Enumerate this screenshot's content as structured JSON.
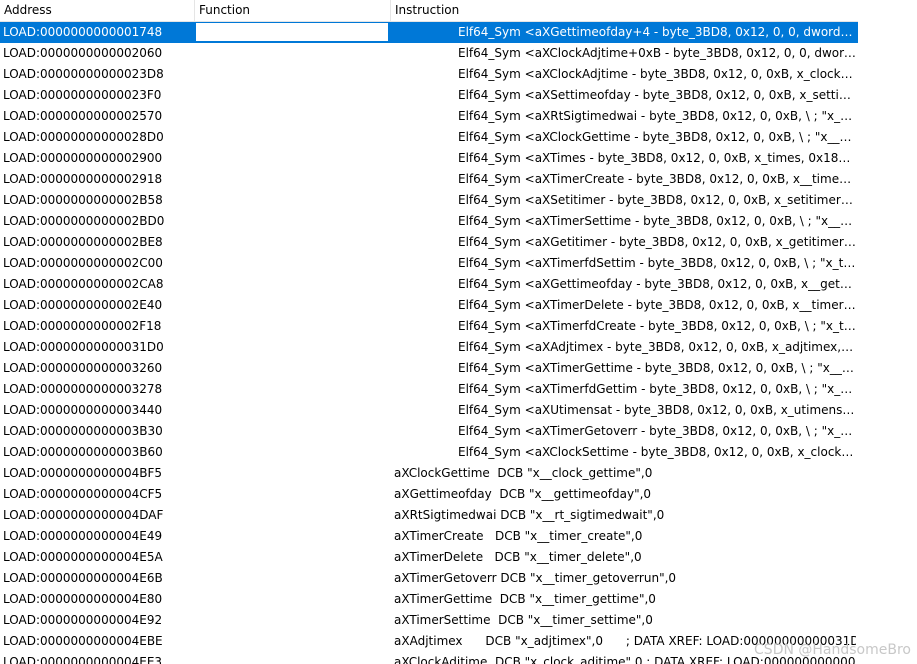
{
  "columns": {
    "address": "Address",
    "function": "Function",
    "instruction": "Instruction"
  },
  "rows": [
    {
      "address": "LOAD:0000000000001748",
      "instruction": "Elf64_Sym <aXGettimeofday+4 - byte_3BD8, 0x12, 0, 0, dword_0, 0..."
    },
    {
      "address": "LOAD:0000000000002060",
      "instruction": "Elf64_Sym <aXClockAdjtime+0xB - byte_3BD8, 0x12, 0, 0, dword_0,..."
    },
    {
      "address": "LOAD:00000000000023D8",
      "instruction": "Elf64_Sym <aXClockAdjtime - byte_3BD8, 0x12, 0, 0xB, x_clock_adjt..."
    },
    {
      "address": "LOAD:00000000000023F0",
      "instruction": "Elf64_Sym <aXSettimeofday - byte_3BD8, 0x12, 0, 0xB, x_settimeof..."
    },
    {
      "address": "LOAD:0000000000002570",
      "instruction": "Elf64_Sym <aXRtSigtimedwai - byte_3BD8, 0x12, 0, 0xB, \\ ; \"x__rt_s..."
    },
    {
      "address": "LOAD:00000000000028D0",
      "instruction": "Elf64_Sym <aXClockGettime - byte_3BD8, 0x12, 0, 0xB, \\ ; \"x__cloc..."
    },
    {
      "address": "LOAD:0000000000002900",
      "instruction": "Elf64_Sym <aXTimes - byte_3BD8, 0x12, 0, 0xB, x_times, 0x18> ; \"x..."
    },
    {
      "address": "LOAD:0000000000002918",
      "instruction": "Elf64_Sym <aXTimerCreate - byte_3BD8, 0x12, 0, 0xB, x__timer_cre..."
    },
    {
      "address": "LOAD:0000000000002B58",
      "instruction": "Elf64_Sym <aXSetitimer - byte_3BD8, 0x12, 0, 0xB, x_setitimer, 0x1..."
    },
    {
      "address": "LOAD:0000000000002BD0",
      "instruction": "Elf64_Sym <aXTimerSettime - byte_3BD8, 0x12, 0, 0xB, \\ ; \"x__time..."
    },
    {
      "address": "LOAD:0000000000002BE8",
      "instruction": "Elf64_Sym <aXGetitimer - byte_3BD8, 0x12, 0, 0xB, x_getitimer, 0x1..."
    },
    {
      "address": "LOAD:0000000000002C00",
      "instruction": "Elf64_Sym <aXTimerfdSettim - byte_3BD8, 0x12, 0, 0xB, \\ ; \"x_timer..."
    },
    {
      "address": "LOAD:0000000000002CA8",
      "instruction": "Elf64_Sym <aXGettimeofday - byte_3BD8, 0x12, 0, 0xB, x__gettime..."
    },
    {
      "address": "LOAD:0000000000002E40",
      "instruction": "Elf64_Sym <aXTimerDelete - byte_3BD8, 0x12, 0, 0xB, x__timer_del..."
    },
    {
      "address": "LOAD:0000000000002F18",
      "instruction": "Elf64_Sym <aXTimerfdCreate - byte_3BD8, 0x12, 0, 0xB, \\ ; \"x_timer..."
    },
    {
      "address": "LOAD:00000000000031D0",
      "instruction": "Elf64_Sym <aXAdjtimex - byte_3BD8, 0x12, 0, 0xB, x_adjtimex, 0x18..."
    },
    {
      "address": "LOAD:0000000000003260",
      "instruction": "Elf64_Sym <aXTimerGettime - byte_3BD8, 0x12, 0, 0xB, \\ ; \"x__time..."
    },
    {
      "address": "LOAD:0000000000003278",
      "instruction": "Elf64_Sym <aXTimerfdGettim - byte_3BD8, 0x12, 0, 0xB, \\ ; \"x_timer..."
    },
    {
      "address": "LOAD:0000000000003440",
      "instruction": "Elf64_Sym <aXUtimensat - byte_3BD8, 0x12, 0, 0xB, x_utimensat, 0x..."
    },
    {
      "address": "LOAD:0000000000003B30",
      "instruction": "Elf64_Sym <aXTimerGetoverr - byte_3BD8, 0x12, 0, 0xB, \\ ; \"x__tim..."
    },
    {
      "address": "LOAD:0000000000003B60",
      "instruction": "Elf64_Sym <aXClockSettime - byte_3BD8, 0x12, 0, 0xB, x_clock_setti..."
    },
    {
      "address": "LOAD:0000000000004BF5",
      "instruction": "aXClockGettime  DCB \"x__clock_gettime\",0"
    },
    {
      "address": "LOAD:0000000000004CF5",
      "instruction": "aXGettimeofday  DCB \"x__gettimeofday\",0"
    },
    {
      "address": "LOAD:0000000000004DAF",
      "instruction": "aXRtSigtimedwai DCB \"x__rt_sigtimedwait\",0"
    },
    {
      "address": "LOAD:0000000000004E49",
      "instruction": "aXTimerCreate   DCB \"x__timer_create\",0"
    },
    {
      "address": "LOAD:0000000000004E5A",
      "instruction": "aXTimerDelete   DCB \"x__timer_delete\",0"
    },
    {
      "address": "LOAD:0000000000004E6B",
      "instruction": "aXTimerGetoverr DCB \"x__timer_getoverrun\",0"
    },
    {
      "address": "LOAD:0000000000004E80",
      "instruction": "aXTimerGettime  DCB \"x__timer_gettime\",0"
    },
    {
      "address": "LOAD:0000000000004E92",
      "instruction": "aXTimerSettime  DCB \"x__timer_settime\",0"
    },
    {
      "address": "LOAD:0000000000004EBE",
      "instruction": "aXAdjtimex      DCB \"x_adjtimex\",0      ; DATA XREF: LOAD:00000000000031D0..."
    },
    {
      "address": "LOAD:0000000000004EE3",
      "instruction": "aXClockAdjtime  DCB \"x_clock_adjtime\",0 ; DATA XREF: LOAD:0000000000000..."
    }
  ],
  "selected_row_index": 0,
  "data_row_start_index": 21,
  "watermark": "CSDN @HandsomeBro",
  "colors": {
    "selection": "#0078d7",
    "header_border": "#e5e5e5"
  }
}
